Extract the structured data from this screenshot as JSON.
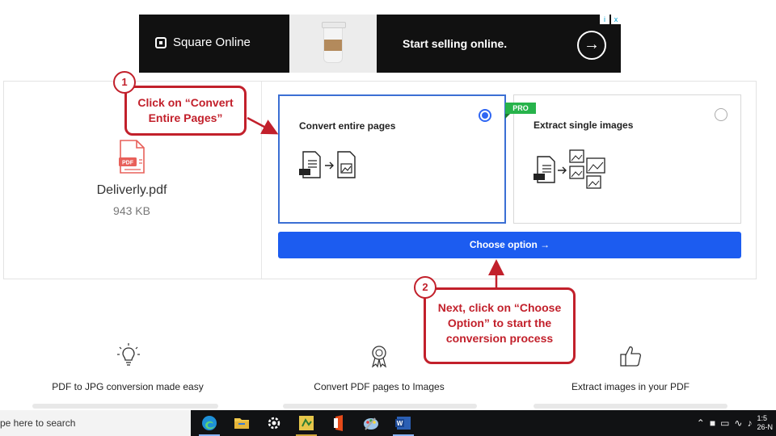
{
  "ad": {
    "brand": "Square Online",
    "headline": "Start selling online.",
    "chip_info": "i",
    "chip_close": "x"
  },
  "file": {
    "badge": "PDF",
    "name": "Deliverly.pdf",
    "size": "943 KB"
  },
  "options": [
    {
      "title": "Convert entire pages",
      "selected": true
    },
    {
      "title": "Extract single images",
      "selected": false,
      "badge": "PRO"
    }
  ],
  "choose_button": {
    "label": "Choose option →"
  },
  "callouts": {
    "step1": {
      "number": "1",
      "line1": "Click on “Convert",
      "line2": "Entire Pages”"
    },
    "step2": {
      "number": "2",
      "line1": "Next, click on “Choose",
      "line2": "Option” to start the",
      "line3": "conversion process"
    }
  },
  "features": [
    {
      "title": "PDF to JPG conversion made easy",
      "icon": "lightbulb-icon"
    },
    {
      "title": "Convert PDF pages to Images",
      "icon": "award-ribbon-icon"
    },
    {
      "title": "Extract images in your PDF",
      "icon": "thumbs-up-icon"
    }
  ],
  "taskbar": {
    "search_placeholder": "pe here to search",
    "apps": [
      "edge-icon",
      "file-explorer-icon",
      "settings-icon",
      "powerpoint-icon",
      "office-icon",
      "paint-icon",
      "word-icon"
    ],
    "clock_time": "1:5",
    "clock_date": "26-N"
  },
  "colors": {
    "accent_blue": "#1c5cf0",
    "callout_red": "#c2202b",
    "pro_green": "#27b34b"
  }
}
